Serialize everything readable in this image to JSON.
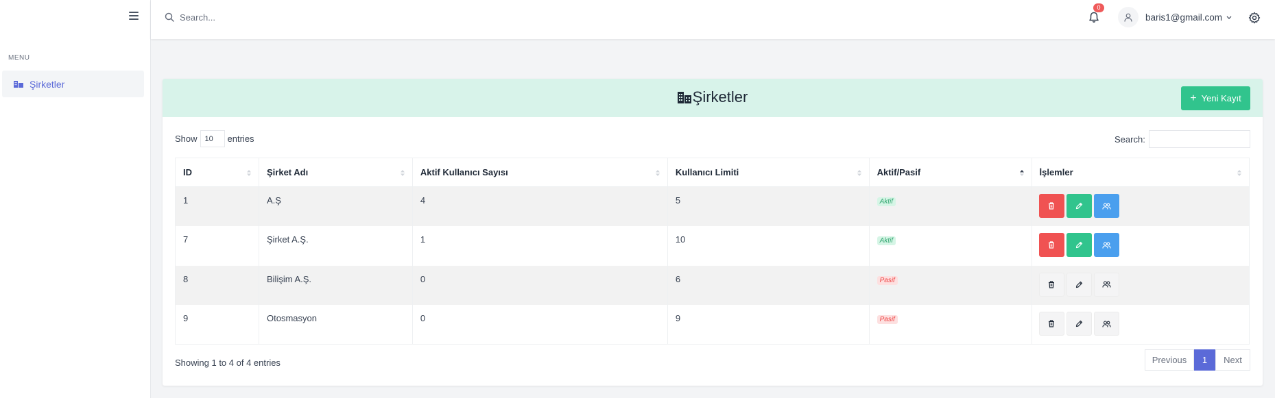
{
  "sidebar": {
    "menu_label": "MENU",
    "items": [
      {
        "label": "Şirketler",
        "icon": "building-icon",
        "active": true
      }
    ]
  },
  "topbar": {
    "search_placeholder": "Search...",
    "notification_count": "0",
    "user_email": "baris1@gmail.com"
  },
  "page": {
    "title": "Şirketler",
    "new_button_label": "Yeni Kayıt",
    "show_label": "Show",
    "entries_value": "10",
    "entries_label": "entries",
    "search_label": "Search:"
  },
  "table": {
    "columns": [
      "ID",
      "Şirket Adı",
      "Aktif Kullanıcı Sayısı",
      "Kullanıcı Limiti",
      "Aktif/Pasif",
      "İşlemler"
    ],
    "rows": [
      {
        "id": "1",
        "name": "A.Ş",
        "active_users": "4",
        "limit": "5",
        "status": "Aktif"
      },
      {
        "id": "7",
        "name": "Şirket A.Ş.",
        "active_users": "1",
        "limit": "10",
        "status": "Aktif"
      },
      {
        "id": "8",
        "name": "Bilişim A.Ş.",
        "active_users": "0",
        "limit": "6",
        "status": "Pasif"
      },
      {
        "id": "9",
        "name": "Otosmasyon",
        "active_users": "0",
        "limit": "9",
        "status": "Pasif"
      }
    ]
  },
  "footer": {
    "info": "Showing 1 to 4 of 4 entries",
    "prev": "Previous",
    "current_page": "1",
    "next": "Next"
  },
  "colors": {
    "accent": "#5b6ad8",
    "header_bg": "#d8f3ea",
    "success": "#31c48d",
    "danger": "#f05252",
    "info": "#4a9fee"
  }
}
